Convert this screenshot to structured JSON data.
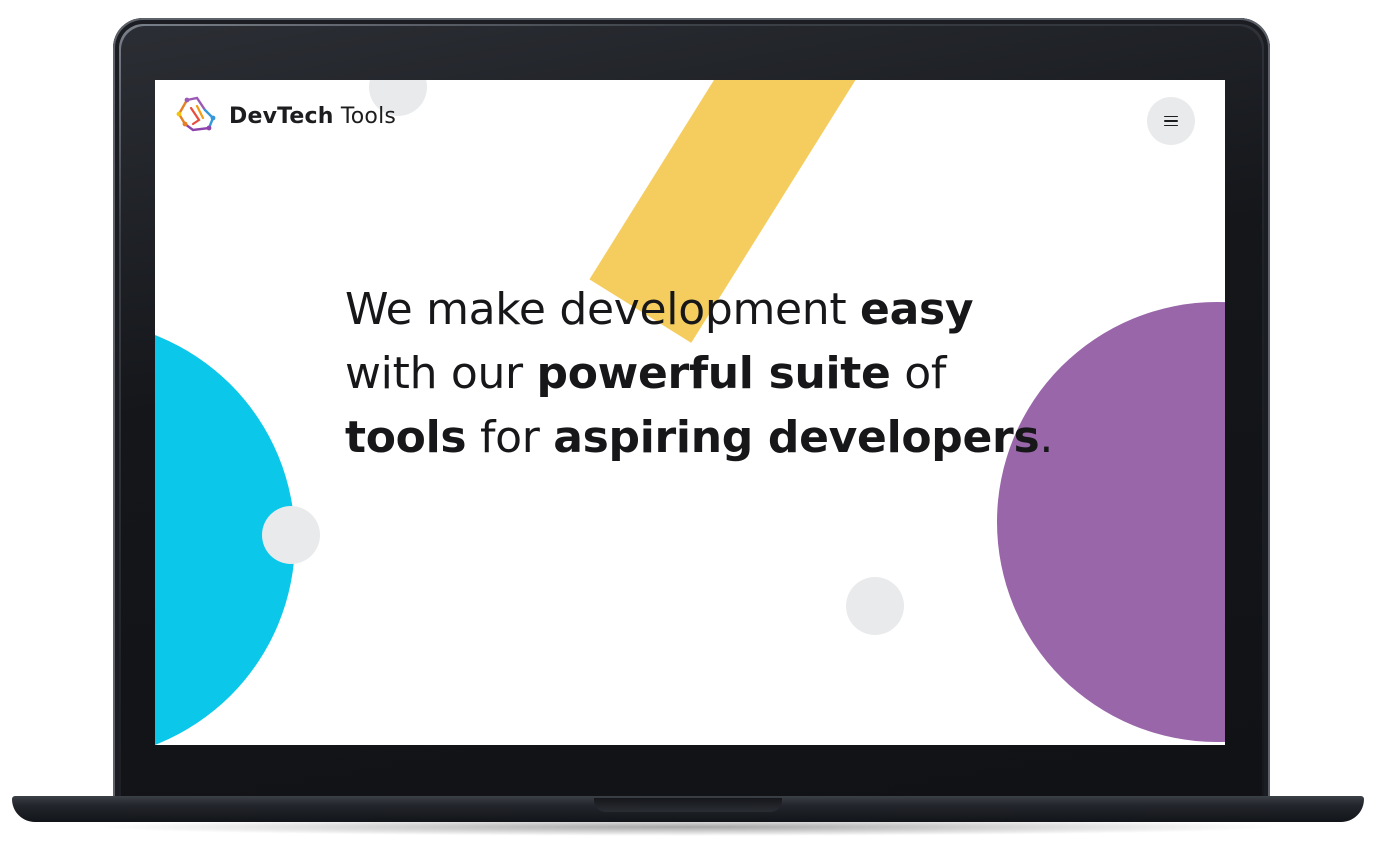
{
  "brand": {
    "name_bold": "DevTech",
    "name_light": "Tools",
    "logo_icon": "hexagon-circuit-logo"
  },
  "header": {
    "menu_icon": "hamburger-menu-icon"
  },
  "hero": {
    "segments": [
      {
        "text": "We make development ",
        "bold": false
      },
      {
        "text": "easy",
        "bold": true
      },
      {
        "text": " with our ",
        "bold": false
      },
      {
        "text": "powerful suite",
        "bold": true
      },
      {
        "text": " of ",
        "bold": false
      },
      {
        "text": "tools",
        "bold": true
      },
      {
        "text": " for ",
        "bold": false
      },
      {
        "text": "aspiring developers",
        "bold": true
      },
      {
        "text": ".",
        "bold": false
      }
    ]
  },
  "colors": {
    "cyan": "#0bc7ea",
    "yellow": "#f5cd5f",
    "purple": "#9966aa",
    "dot_gray": "#e9eaec",
    "text": "#17171a"
  }
}
